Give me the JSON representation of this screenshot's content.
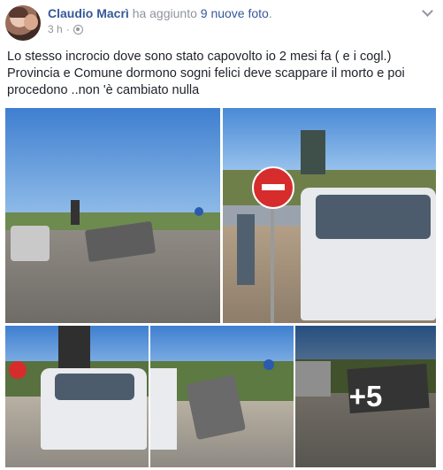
{
  "post": {
    "author": "Claudio Macrì",
    "action": "ha aggiunto",
    "photos_link": "9 nuove foto",
    "period": ".",
    "timestamp": "3 h",
    "separator": "·",
    "privacy_icon": "globe-icon",
    "options_icon": "chevron-down-icon",
    "text": "Lo stesso incrocio dove sono stato capovolto io 2 mesi fa ( e i cogl.) Provincia e Comune dormono sogni felici deve scappare il morto e poi procedono ..non 'è cambiato nulla"
  },
  "gallery": {
    "more_label": "+5"
  },
  "colors": {
    "link": "#365899",
    "meta": "#90949c",
    "text": "#1d2129"
  }
}
